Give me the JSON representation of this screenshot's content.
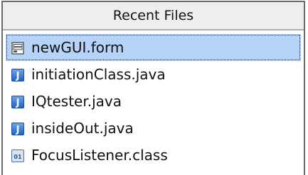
{
  "header": {
    "title": "Recent Files"
  },
  "files": [
    {
      "name": "newGUI.form",
      "icon": "form-icon",
      "selected": true
    },
    {
      "name": "initiationClass.java",
      "icon": "java-file-icon",
      "selected": false
    },
    {
      "name": "IQtester.java",
      "icon": "java-file-icon",
      "selected": false
    },
    {
      "name": "insideOut.java",
      "icon": "java-file-icon",
      "selected": false
    },
    {
      "name": "FocusListener.class",
      "icon": "class-file-icon",
      "selected": false
    }
  ],
  "colors": {
    "selection": "#b7d3f7",
    "java_icon": "#2b6fd6",
    "border": "#6b6b6b"
  }
}
